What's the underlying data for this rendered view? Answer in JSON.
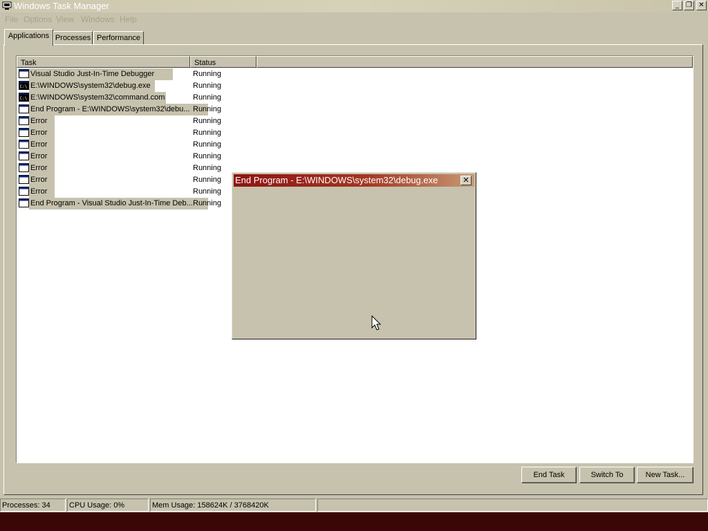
{
  "window": {
    "title": "Windows Task Manager"
  },
  "title_buttons": {
    "minimize": "_",
    "restore": "❐",
    "close": "✕"
  },
  "menu": [
    "File",
    "Options",
    "View",
    "Windows",
    "Help"
  ],
  "tabs": [
    {
      "label": "Applications",
      "active": true
    },
    {
      "label": "Processes",
      "active": false
    },
    {
      "label": "Performance",
      "active": false
    }
  ],
  "list": {
    "columns": [
      "Task",
      "Status"
    ],
    "rows": [
      {
        "task": "Visual Studio Just-In-Time Debugger",
        "status": "Running",
        "icon": "window-icon"
      },
      {
        "task": "E:\\WINDOWS\\system32\\debug.exe",
        "status": "Running",
        "icon": "console-icon"
      },
      {
        "task": "E:\\WINDOWS\\system32\\command.com",
        "status": "Running",
        "icon": "console-icon"
      },
      {
        "task": "End Program - E:\\WINDOWS\\system32\\debu...",
        "status": "Running",
        "icon": "window-icon"
      },
      {
        "task": "Error",
        "status": "Running",
        "icon": "window-icon"
      },
      {
        "task": "Error",
        "status": "Running",
        "icon": "window-icon"
      },
      {
        "task": "Error",
        "status": "Running",
        "icon": "window-icon"
      },
      {
        "task": "Error",
        "status": "Running",
        "icon": "window-icon"
      },
      {
        "task": "Error",
        "status": "Running",
        "icon": "window-icon"
      },
      {
        "task": "Error",
        "status": "Running",
        "icon": "window-icon"
      },
      {
        "task": "Error",
        "status": "Running",
        "icon": "window-icon"
      },
      {
        "task": "End Program - Visual Studio Just-In-Time Deb...",
        "status": "Running",
        "icon": "window-icon"
      }
    ]
  },
  "buttons": {
    "end_task": "End Task",
    "switch_to": "Switch To",
    "new_task": "New Task..."
  },
  "statusbar": {
    "processes": "Processes: 34",
    "cpu": "CPU Usage: 0%",
    "mem": "Mem Usage: 158624K / 3768420K"
  },
  "dialog": {
    "title": "End Program - E:\\WINDOWS\\system32\\debug.exe",
    "close": "✕"
  },
  "colors": {
    "face": "#c6c2ad",
    "dialog_title": "#8e1413",
    "taskbar": "#3a0707"
  }
}
